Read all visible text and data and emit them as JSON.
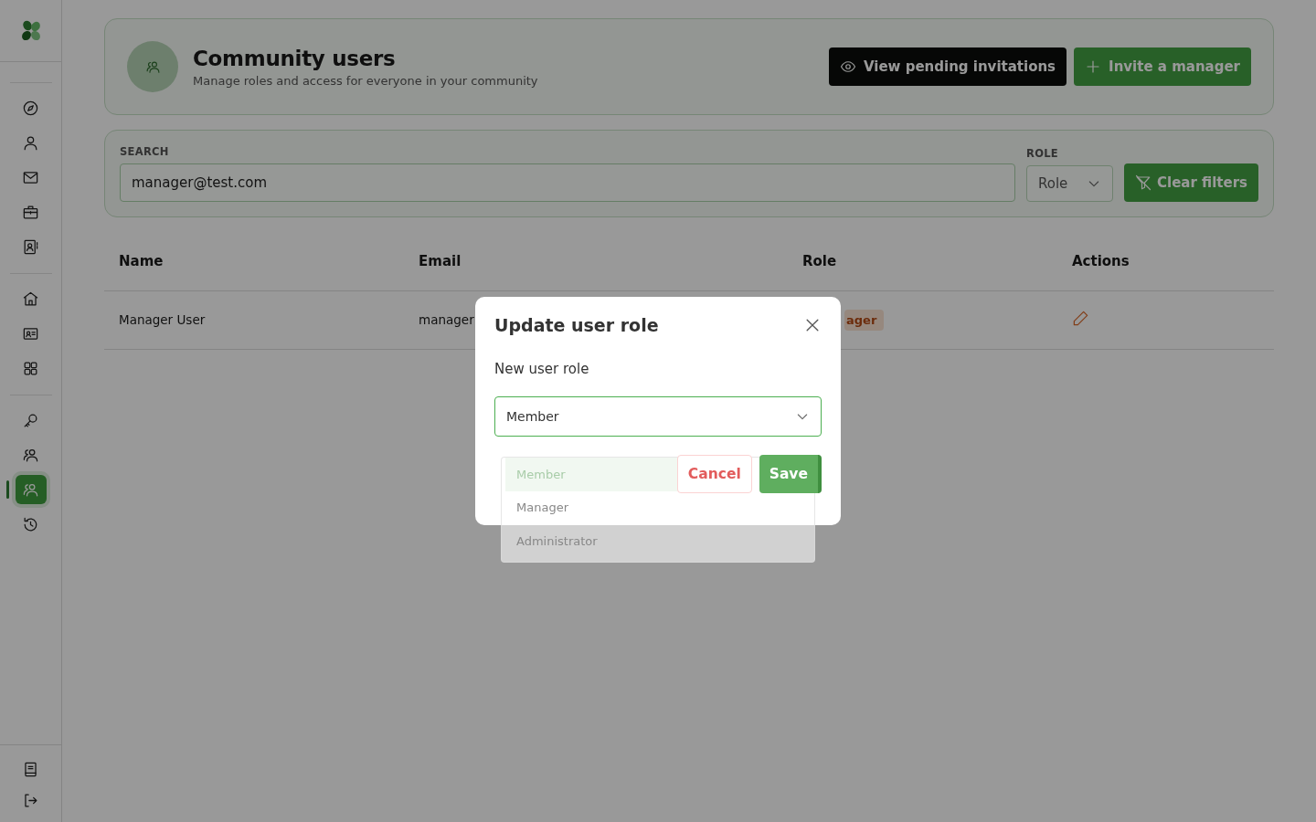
{
  "sidebar": {
    "groups": [
      [
        {
          "selected": false
        },
        {
          "selected": false
        },
        {
          "selected": false
        },
        {
          "selected": false
        },
        {
          "selected": false
        }
      ],
      [
        {
          "selected": false
        },
        {
          "selected": false
        },
        {
          "selected": false
        }
      ],
      [
        {
          "selected": false
        },
        {
          "selected": false
        },
        {
          "selected": true
        },
        {
          "selected": false
        }
      ]
    ],
    "bottom": [
      {
        "selected": false
      },
      {
        "selected": false
      }
    ]
  },
  "header": {
    "title": "Community users",
    "subtitle": "Manage roles and access for everyone in your community",
    "buttons": [
      {
        "kind": "dark",
        "label": "View pending invitations"
      },
      {
        "kind": "primary",
        "label": "Invite a manager"
      }
    ]
  },
  "filters": {
    "search_label": "SEARCH",
    "search_value": "manager@test.com",
    "role_label": "ROLE",
    "role_placeholder": "Role",
    "clear_label": "Clear filters"
  },
  "table": {
    "columns": [
      "Name",
      "Email",
      "Role",
      "Actions"
    ],
    "rows": [
      {
        "name": "Manager User",
        "email": "manager",
        "role": "ager"
      }
    ]
  },
  "dialog": {
    "title": "Update user role",
    "field_label": "New user role",
    "value": "Member",
    "options": [
      {
        "label": "Member",
        "selected": true
      },
      {
        "label": "Manager",
        "selected": false
      },
      {
        "label": "Administrator",
        "selected": false
      }
    ],
    "buttons": [
      {
        "kind": "cancel",
        "label": "Cancel"
      },
      {
        "kind": "save",
        "label": "Save"
      }
    ]
  }
}
